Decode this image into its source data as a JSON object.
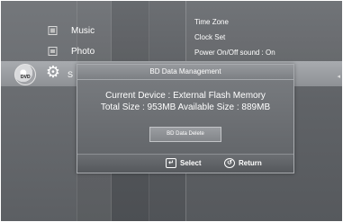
{
  "sidebar": {
    "items": [
      {
        "label": "Music",
        "icon": "music-note-icon"
      },
      {
        "label": "Photo",
        "icon": "photo-icon"
      },
      {
        "label": "S",
        "icon": "gear-icon"
      }
    ],
    "disc_label": "DVD"
  },
  "settings_list": {
    "items": [
      {
        "label": "Time Zone"
      },
      {
        "label": "Clock Set"
      },
      {
        "label": "Power On/Off sound  :  On"
      }
    ]
  },
  "dialog": {
    "title": "BD Data Management",
    "current_device": "Current Device : External Flash Memory",
    "sizes": "Total Size : 953MB    Available Size : 889MB",
    "delete_button": "BD Data Delete",
    "footer": {
      "select_label": "Select",
      "return_label": "Return"
    }
  }
}
